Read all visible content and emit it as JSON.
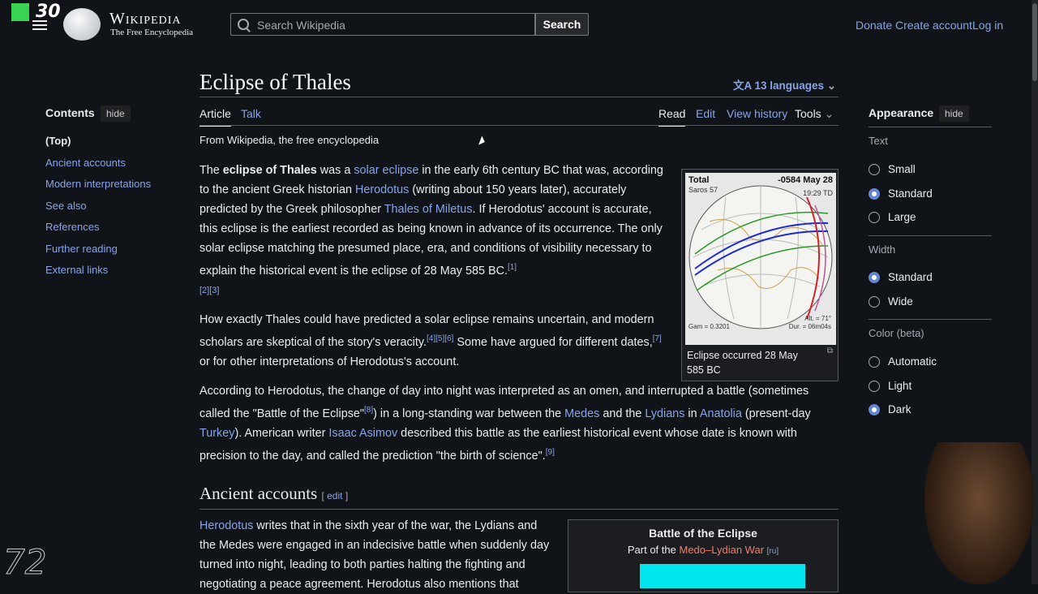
{
  "header": {
    "badge": "30",
    "wordmark": "Wikipedia",
    "tagline": "The Free Encyclopedia",
    "search_placeholder": "Search Wikipedia",
    "search_button": "Search",
    "donate": "Donate",
    "create_account": "Create account",
    "login": "Log in"
  },
  "toc": {
    "title": "Contents",
    "hide": "hide",
    "items": [
      "(Top)",
      "Ancient accounts",
      "Modern interpretations",
      "See also",
      "References",
      "Further reading",
      "External links"
    ]
  },
  "page": {
    "title": "Eclipse of Thales",
    "languages": "13 languages",
    "tabs": {
      "article": "Article",
      "talk": "Talk",
      "read": "Read",
      "edit": "Edit",
      "history": "View history",
      "tools": "Tools"
    },
    "from": "From Wikipedia, the free encyclopedia",
    "section_heading": "Ancient accounts",
    "section_edit": "edit"
  },
  "thumb": {
    "top_left": "Total",
    "top_right": "-0584 May 28",
    "saros": "Saros 57",
    "time": "19:29 TD",
    "alt": "Alt. = 71°",
    "dur": "Dur. = 06m04s",
    "gam": "Gam = 0.3201",
    "caption": "Eclipse occurred 28 May 585 BC"
  },
  "battle": {
    "title": "Battle of the Eclipse",
    "part_of": "Part of the",
    "war": "Medo–Lydian War",
    "ru": "ru"
  },
  "appearance": {
    "title": "Appearance",
    "hide": "hide",
    "text_label": "Text",
    "text_opts": [
      "Small",
      "Standard",
      "Large"
    ],
    "width_label": "Width",
    "width_opts": [
      "Standard",
      "Wide"
    ],
    "color_label": "Color (beta)",
    "color_opts": [
      "Automatic",
      "Light",
      "Dark"
    ]
  },
  "watermark": "72"
}
